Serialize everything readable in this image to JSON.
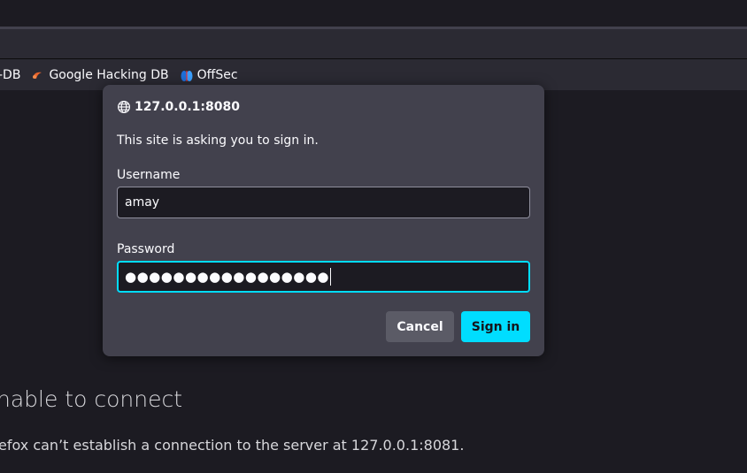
{
  "bookmarks": {
    "items": [
      {
        "label": "-DB"
      },
      {
        "label": "Google Hacking DB",
        "icon": "ghdb-icon"
      },
      {
        "label": "OffSec",
        "icon": "offsec-icon"
      }
    ]
  },
  "error_page": {
    "title": "nable to connect",
    "description": "efox can’t establish a connection to the server at 127.0.0.1:8081."
  },
  "auth_dialog": {
    "origin": "127.0.0.1:8080",
    "origin_icon": "globe-icon",
    "message": "This site is asking you to sign in.",
    "username_label": "Username",
    "username_value": "amay",
    "password_label": "Password",
    "password_value": "●●●●●●●●●●●●●●●●●",
    "cancel_label": "Cancel",
    "signin_label": "Sign in"
  },
  "colors": {
    "accent": "#00ddff",
    "dialog_bg": "#42414d",
    "page_bg": "#1c1b22"
  }
}
